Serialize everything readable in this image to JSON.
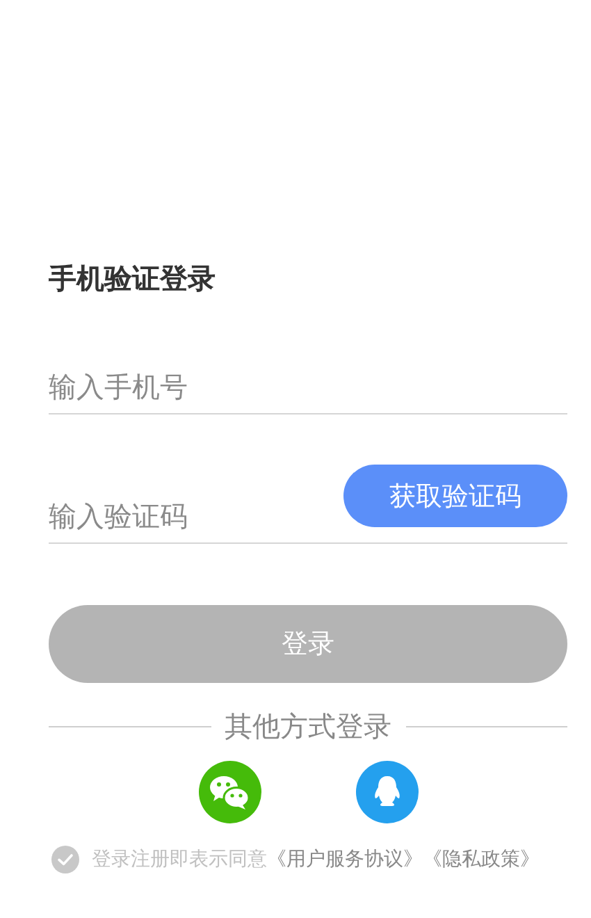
{
  "title": "手机验证登录",
  "phone_field": {
    "placeholder": "输入手机号"
  },
  "code_field": {
    "placeholder": "输入验证码"
  },
  "get_code_button": "获取验证码",
  "login_button": {
    "label": "登录",
    "disabled": true
  },
  "other_login": {
    "label": "其他方式登录",
    "options": [
      {
        "kind": "wechat"
      },
      {
        "kind": "qq"
      }
    ]
  },
  "agreement": {
    "checked": false,
    "text": "登录注册即表示同意",
    "links": [
      "《用户服务协议》",
      "《隐私政策》"
    ]
  }
}
